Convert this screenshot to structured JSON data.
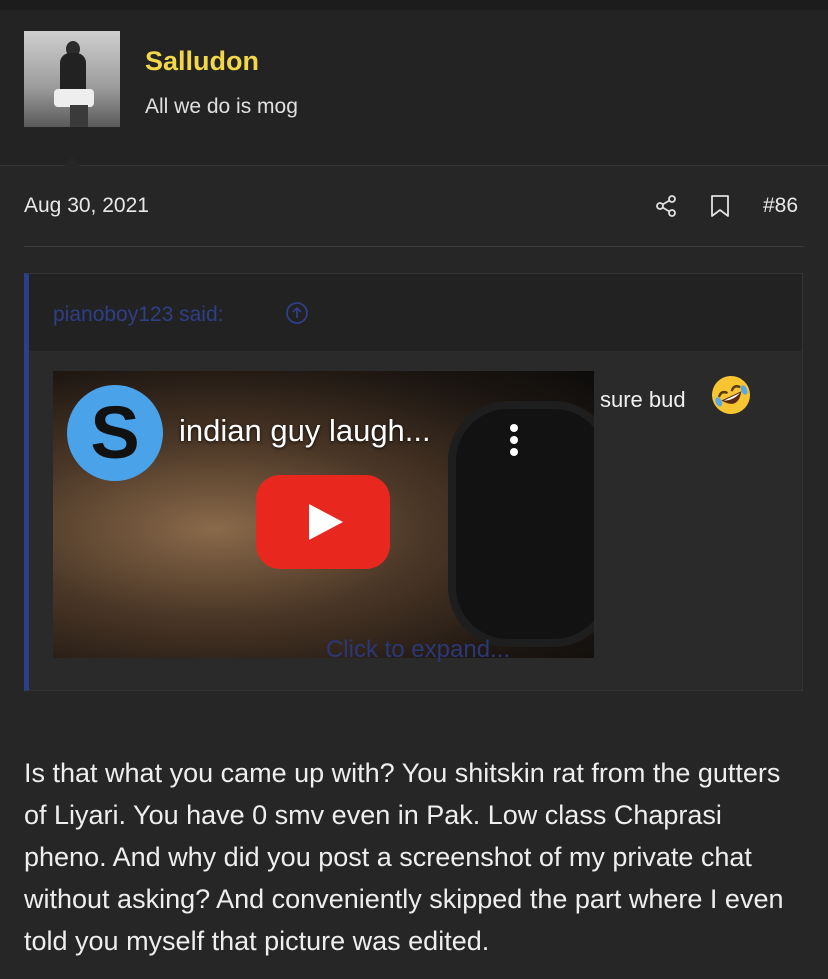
{
  "user": {
    "name": "Salludon",
    "title": "All we do is mog",
    "avatar_icon": "user-avatar-photo"
  },
  "post": {
    "date": "Aug 30, 2021",
    "number": "#86",
    "share_icon": "share-icon",
    "bookmark_icon": "bookmark-icon"
  },
  "quote": {
    "author_line": "pianoboy123 said:",
    "video": {
      "channel_initial": "S",
      "title": "indian guy laugh...",
      "play_icon": "play-icon",
      "menu_icon": "more-vertical-icon"
    },
    "text": "sure bud",
    "emoji_icon": "rolling-on-floor-laughing-emoji",
    "expand_label": "Click to expand..."
  },
  "body": {
    "text": "Is that what you came up with? You shitskin rat from the gutters of Liyari. You have 0 smv even in Pak. Low class Chaprasi pheno. And why did you post a screenshot of my private chat without asking? And conveniently skipped the part where I even told you myself that picture was edited."
  },
  "colors": {
    "background": "#262626",
    "username": "#f2d849",
    "quote_accent": "#2b3f8a",
    "play_button": "#e8281e"
  }
}
